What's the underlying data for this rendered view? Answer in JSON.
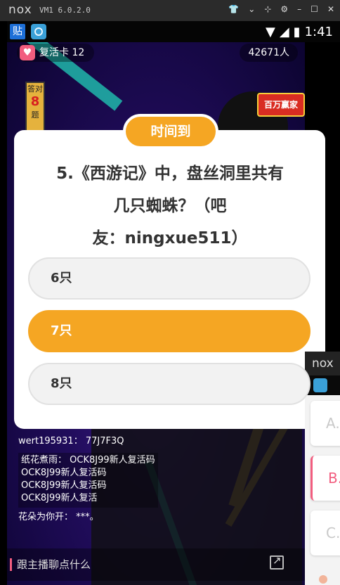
{
  "emulator": {
    "logo": "nox",
    "vm_label": "VM1 6.0.2.0",
    "controls": [
      "shirt-icon",
      "chevron-down-icon",
      "pin-icon",
      "gear-icon",
      "minimize-icon",
      "maximize-icon",
      "close-icon"
    ]
  },
  "statusbar": {
    "app1_label": "贴",
    "time": "1:41"
  },
  "live": {
    "lives_label": "复活卡 12",
    "viewers": "42671人",
    "counter_top": "答对",
    "counter_num": "8",
    "counter_bottom": "题",
    "badge_brand": "百万赢家"
  },
  "quiz": {
    "status_badge": "时间到",
    "question_line1": "5.《西游记》中，盘丝洞里共有",
    "question_line2": "几只蜘蛛？（吧",
    "question_line3": "友：ningxue511）",
    "options": [
      "6只",
      "7只",
      "8只"
    ],
    "selected_index": 1
  },
  "chat": {
    "line1": "wert195931： 77J7F3Q",
    "line2": "纸花煮雨： OCK8J99新人复活码",
    "line3": "OCK8J99新人复活码",
    "line4": "OCK8J99新人复活码",
    "line5": "OCK8J99新人复活",
    "line6": "花朵为你开： ***。"
  },
  "input": {
    "placeholder": "跟主播聊点什么"
  },
  "side_window": {
    "logo": "nox",
    "options": [
      "A.",
      "B.",
      "C."
    ]
  },
  "colors": {
    "accent": "#f5a623",
    "pink": "#f25d7f",
    "background": "#200c5a"
  }
}
